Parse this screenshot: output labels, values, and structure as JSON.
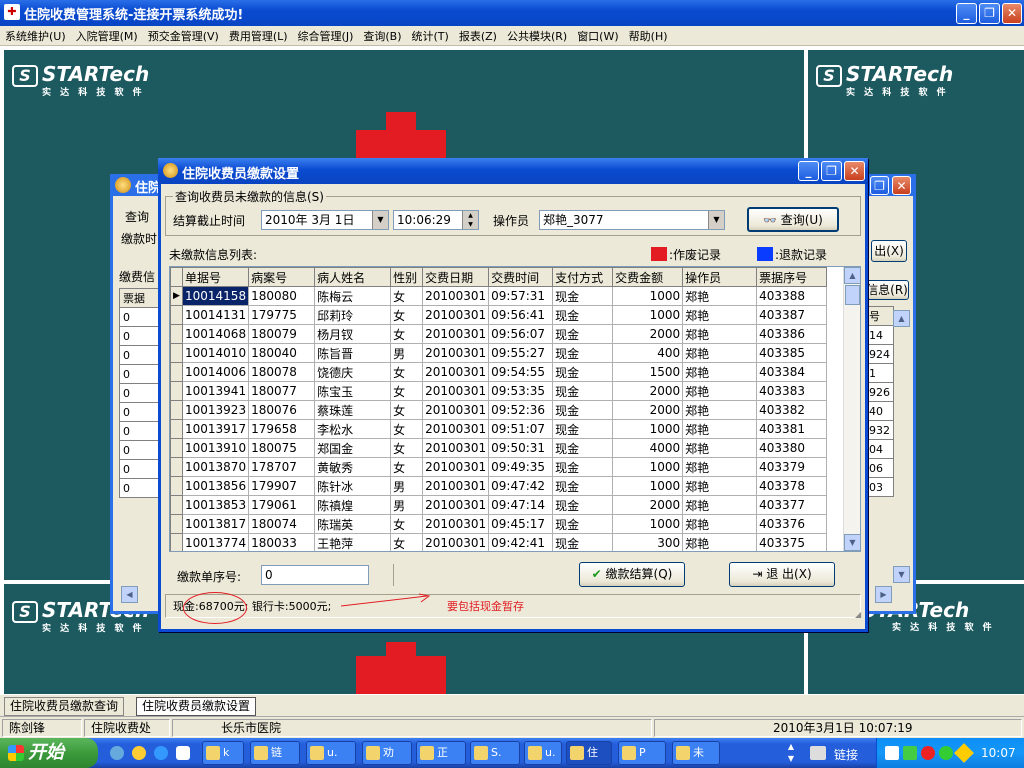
{
  "app": {
    "title": "住院收费管理系统-连接开票系统成功!",
    "icon": "app-icon",
    "window_controls": {
      "minimize": "minimize-icon",
      "maximize": "maximize-icon",
      "close": "close-icon"
    }
  },
  "menu": [
    "系统维护(U)",
    "入院管理(M)",
    "预交金管理(V)",
    "费用管理(L)",
    "综合管理(J)",
    "查询(B)",
    "统计(T)",
    "报表(Z)",
    "公共模块(R)",
    "窗口(W)",
    "帮助(H)"
  ],
  "logo": {
    "brand": "STARTech",
    "sub": "实 达 科 技 软 件"
  },
  "colors": {
    "titlebar": "#0a4bd1",
    "desktop_teal": "#1c5a60",
    "void_red": "#e21c22",
    "refund_blue": "#0a3cff",
    "selection": "#0a246a"
  },
  "back_window": {
    "title": "住院",
    "label_query": "查询",
    "label_paytime": "缴款时",
    "label_list": "缴费信",
    "grid_header": "票据",
    "rows": [
      "0",
      "0",
      "0",
      "0",
      "0",
      "0",
      "0",
      "0",
      "0",
      "0"
    ],
    "right_btn1": "出(X)",
    "right_btn2": "信息(R)",
    "right_header": "号",
    "right_values": [
      "14",
      "924",
      "1",
      "926",
      "40",
      "932",
      "04",
      "06",
      "03"
    ]
  },
  "dialog": {
    "title": "住院收费员缴款设置",
    "group_title": "查询收费员未缴款的信息(S)",
    "cutoff_label": "结算截止时间",
    "date_value": "2010年 3月 1日",
    "time_value": "10:06:29",
    "operator_label": "操作员",
    "operator_value": "郑艳_3077",
    "query_button": "查询(U)",
    "list_label": "未缴款信息列表:",
    "legend_void": ":作废记录",
    "legend_refund": ":退款记录",
    "columns": [
      "单据号",
      "病案号",
      "病人姓名",
      "性别",
      "交费日期",
      "交费时间",
      "支付方式",
      "交费金额",
      "操作员",
      "票据序号"
    ],
    "rows": [
      [
        "10014158",
        "180080",
        "陈梅云",
        "女",
        "20100301",
        "09:57:31",
        "现金",
        "1000",
        "郑艳",
        "403388"
      ],
      [
        "10014131",
        "179775",
        "邱莉玲",
        "女",
        "20100301",
        "09:56:41",
        "现金",
        "1000",
        "郑艳",
        "403387"
      ],
      [
        "10014068",
        "180079",
        "杨月钗",
        "女",
        "20100301",
        "09:56:07",
        "现金",
        "2000",
        "郑艳",
        "403386"
      ],
      [
        "10014010",
        "180040",
        "陈旨晋",
        "男",
        "20100301",
        "09:55:27",
        "现金",
        "400",
        "郑艳",
        "403385"
      ],
      [
        "10014006",
        "180078",
        "饶德庆",
        "女",
        "20100301",
        "09:54:55",
        "现金",
        "1500",
        "郑艳",
        "403384"
      ],
      [
        "10013941",
        "180077",
        "陈宝玉",
        "女",
        "20100301",
        "09:53:35",
        "现金",
        "2000",
        "郑艳",
        "403383"
      ],
      [
        "10013923",
        "180076",
        "蔡珠莲",
        "女",
        "20100301",
        "09:52:36",
        "现金",
        "2000",
        "郑艳",
        "403382"
      ],
      [
        "10013917",
        "179658",
        "李松水",
        "女",
        "20100301",
        "09:51:07",
        "现金",
        "1000",
        "郑艳",
        "403381"
      ],
      [
        "10013910",
        "180075",
        "郑国金",
        "女",
        "20100301",
        "09:50:31",
        "现金",
        "4000",
        "郑艳",
        "403380"
      ],
      [
        "10013870",
        "178707",
        "黄敏秀",
        "女",
        "20100301",
        "09:49:35",
        "现金",
        "1000",
        "郑艳",
        "403379"
      ],
      [
        "10013856",
        "179907",
        "陈针冰",
        "男",
        "20100301",
        "09:47:42",
        "现金",
        "1000",
        "郑艳",
        "403378"
      ],
      [
        "10013853",
        "179061",
        "陈禛煌",
        "男",
        "20100301",
        "09:47:14",
        "现金",
        "2000",
        "郑艳",
        "403377"
      ],
      [
        "10013817",
        "180074",
        "陈瑞英",
        "女",
        "20100301",
        "09:45:17",
        "现金",
        "1000",
        "郑艳",
        "403376"
      ],
      [
        "10013774",
        "180033",
        "王艳萍",
        "女",
        "20100301",
        "09:42:41",
        "现金",
        "300",
        "郑艳",
        "403375"
      ]
    ],
    "serial_label": "缴款单序号:",
    "serial_value": "0",
    "settle_button": "缴款结算(Q)",
    "exit_button": "退 出(X)",
    "summary": "现金:68700元; 银行卡:5000元;",
    "annotation": "要包括现金暂存"
  },
  "tabs": [
    "住院收费员缴款查询",
    "住院收费员缴款设置"
  ],
  "status": {
    "user": "陈剑锋",
    "dept": "住院收费处",
    "hospital": "长乐市医院",
    "datetime": "2010年3月1日 10:07:19"
  },
  "taskbar": {
    "start": "开始",
    "items": [
      "k",
      "链",
      "u.",
      "劝",
      "正",
      "S.",
      "u.",
      "住",
      "P",
      "未"
    ],
    "link_label": "链接",
    "clock": "10:07"
  }
}
